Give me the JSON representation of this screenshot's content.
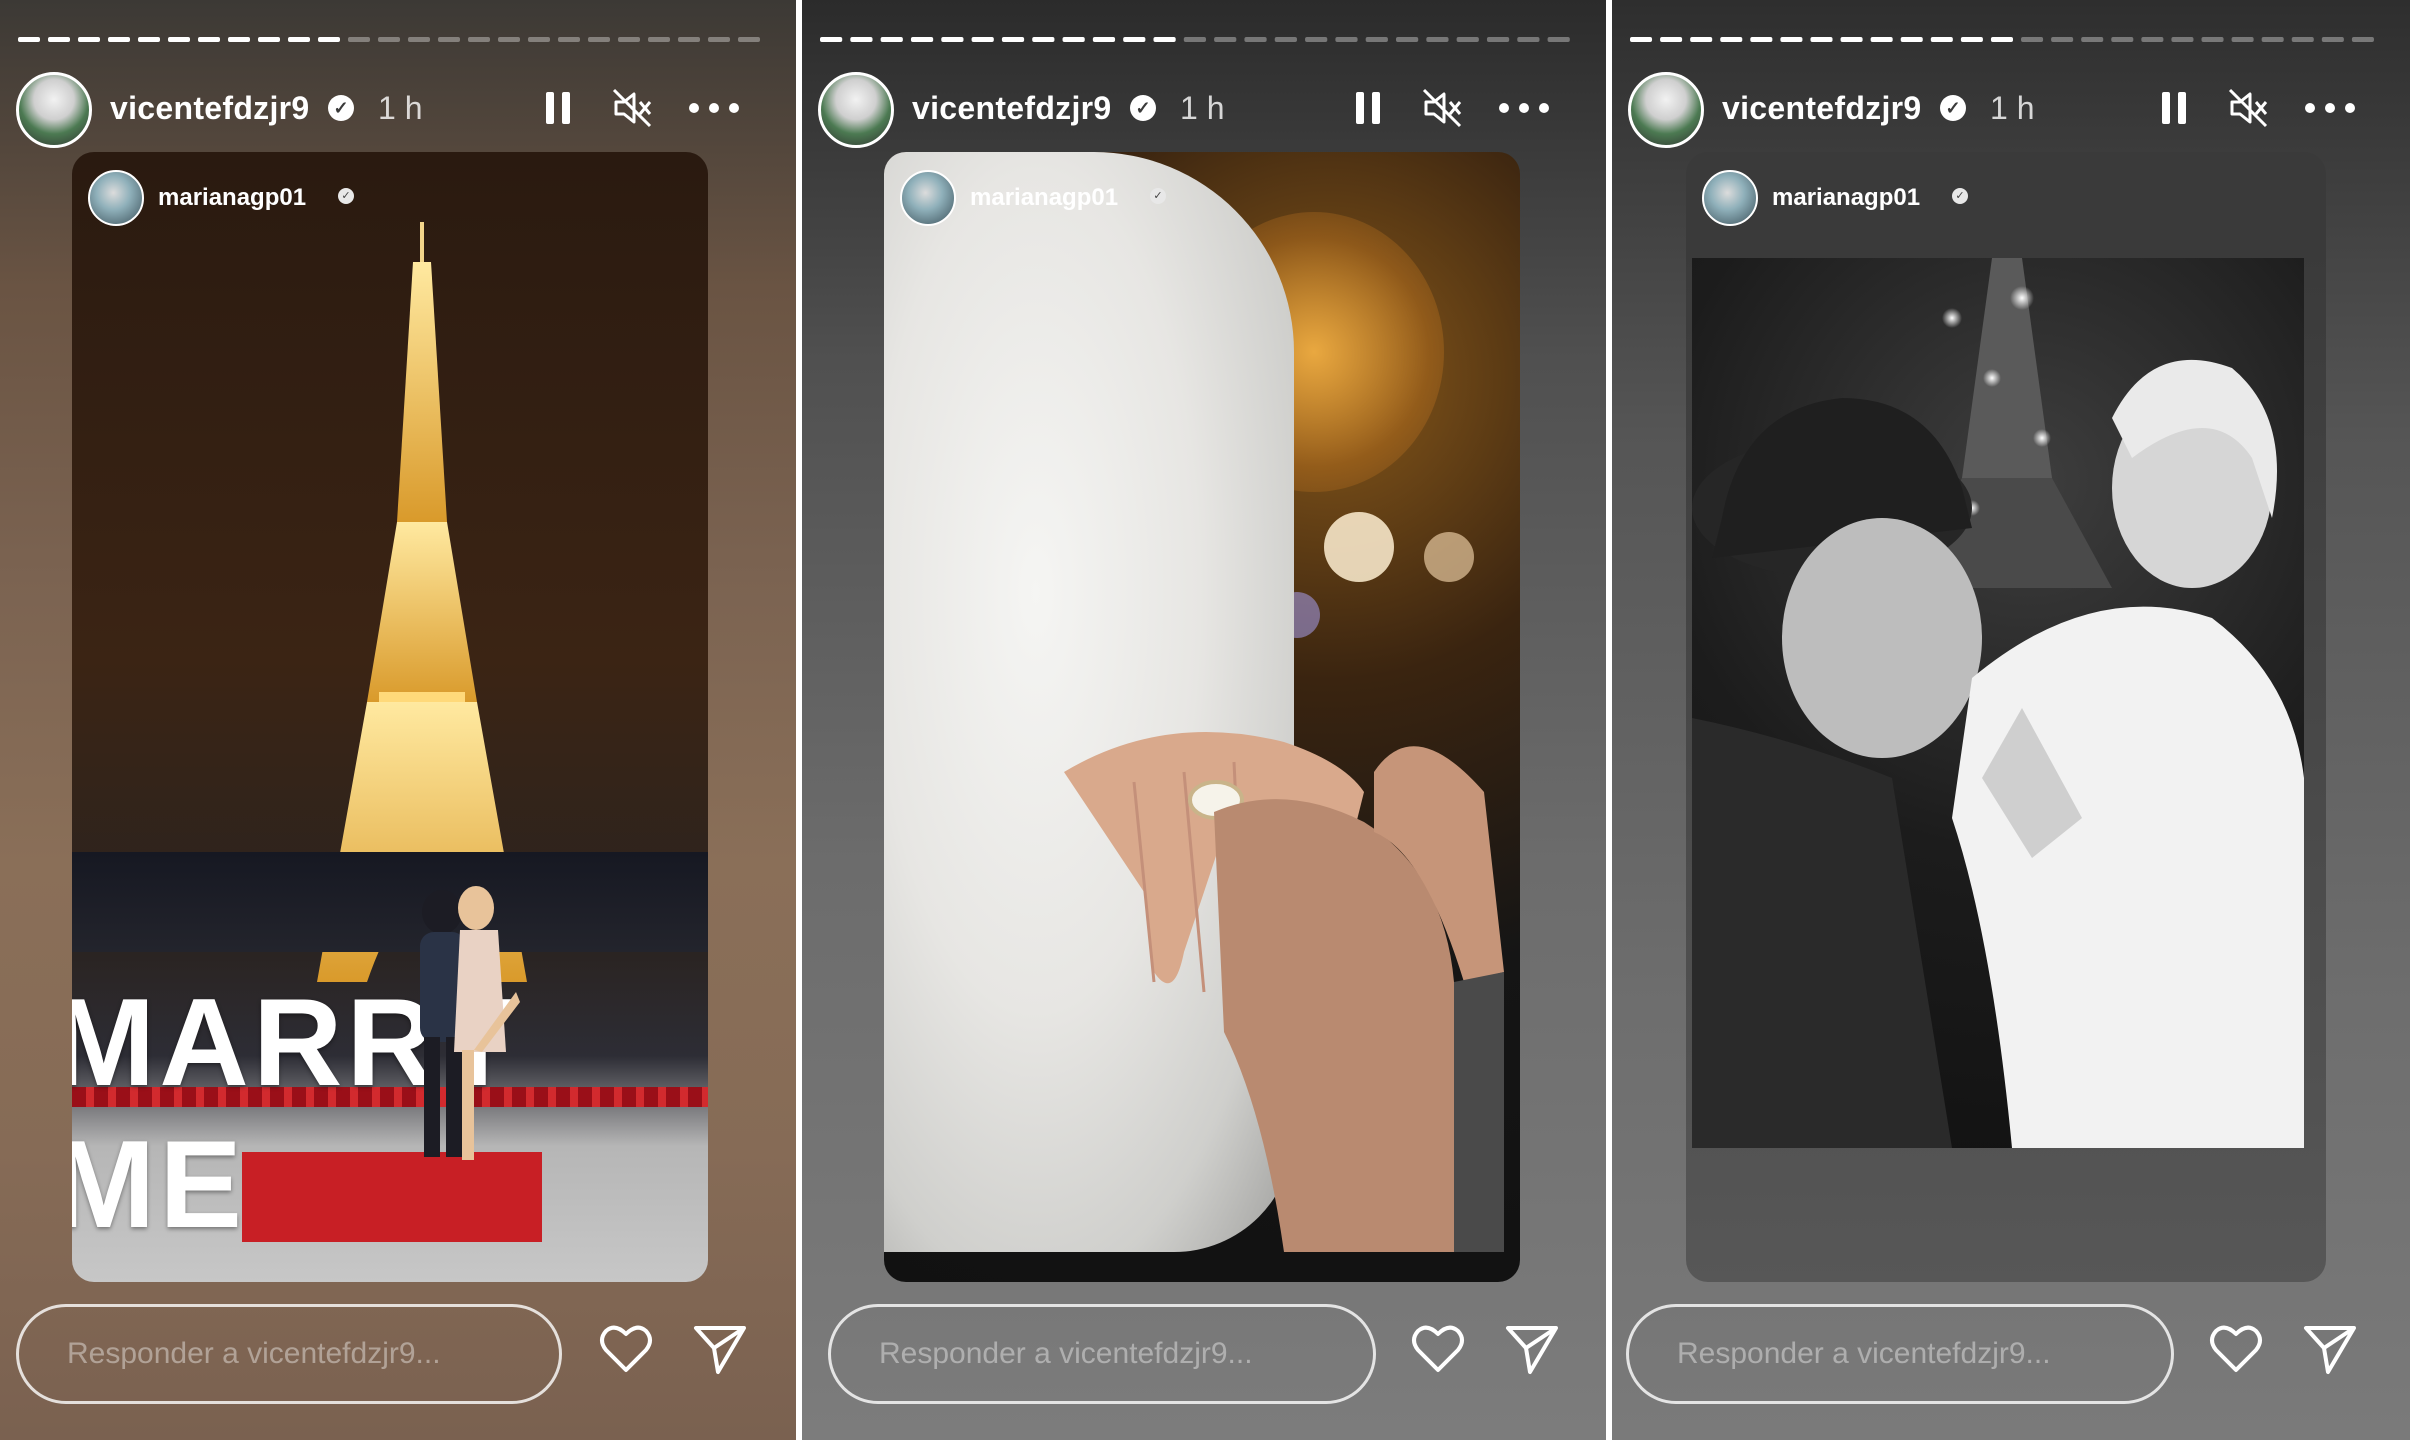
{
  "stories": [
    {
      "username": "vicentefdzjr9",
      "time": "1 h",
      "shared_username": "marianagp01",
      "overlay_text": "MARRY ME",
      "reply_placeholder": "Responder a vicentefdzjr9...",
      "progress": 0.43
    },
    {
      "username": "vicentefdzjr9",
      "time": "1 h",
      "shared_username": "marianagp01",
      "reply_placeholder": "Responder a vicentefdzjr9...",
      "progress": 0.48
    },
    {
      "username": "vicentefdzjr9",
      "time": "1 h",
      "shared_username": "marianagp01",
      "reply_placeholder": "Responder a vicentefdzjr9...",
      "progress": 0.52
    }
  ],
  "icons": {
    "pause": "pause-icon",
    "mute": "mute-icon",
    "more": "more-icon",
    "like": "heart-icon",
    "share": "send-icon",
    "verified": "verified-badge-icon"
  },
  "colors": {
    "text": "#ffffff",
    "carpet": "#c31d22"
  }
}
